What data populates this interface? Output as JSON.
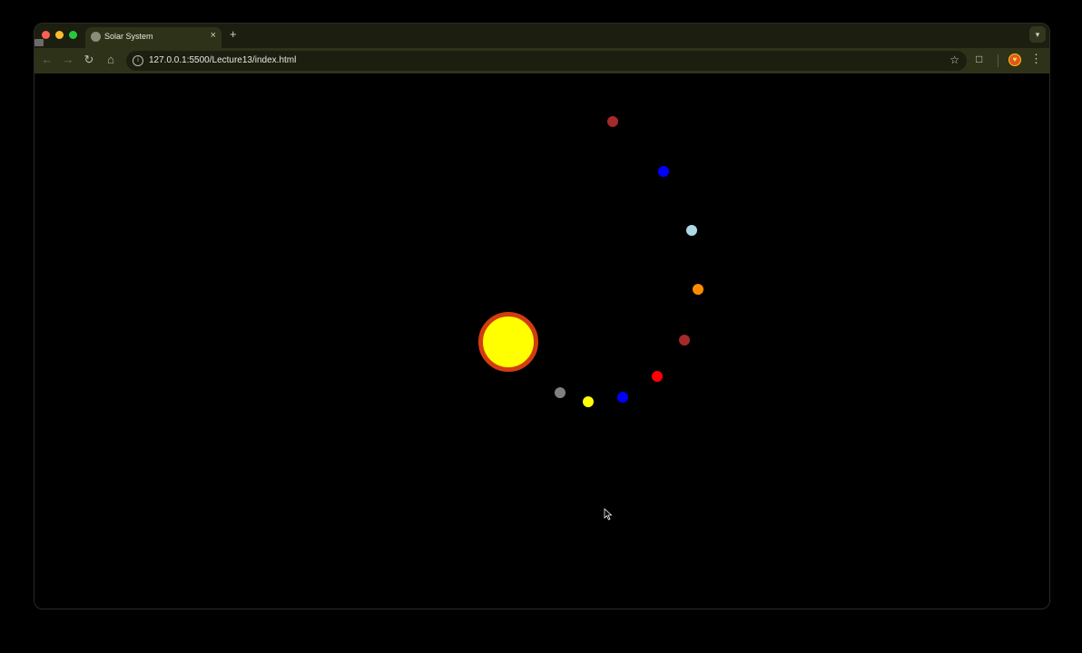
{
  "browser": {
    "tab_title": "Solar System",
    "close_glyph": "×",
    "new_tab_glyph": "+",
    "url": "127.0.0.1:5500/Lecture13/index.html",
    "back_icon": "back-arrow-icon",
    "forward_icon": "forward-arrow-icon",
    "reload_icon": "reload-icon",
    "home_icon": "home-icon",
    "bookmark_icon": "star-icon",
    "extensions_icon": "puzzle-icon",
    "menu_icon": "kebab-menu-icon"
  },
  "scene": {
    "background": "#000000",
    "sun": {
      "core_color": "#ffff00",
      "ring_color": "#d23c10"
    },
    "planet_colors": [
      "#808080",
      "#ffff00",
      "#0000ff",
      "#ff0000",
      "#a52a2a",
      "#ff8c00",
      "#add8e6",
      "#0000ff",
      "#a52a2a"
    ]
  }
}
